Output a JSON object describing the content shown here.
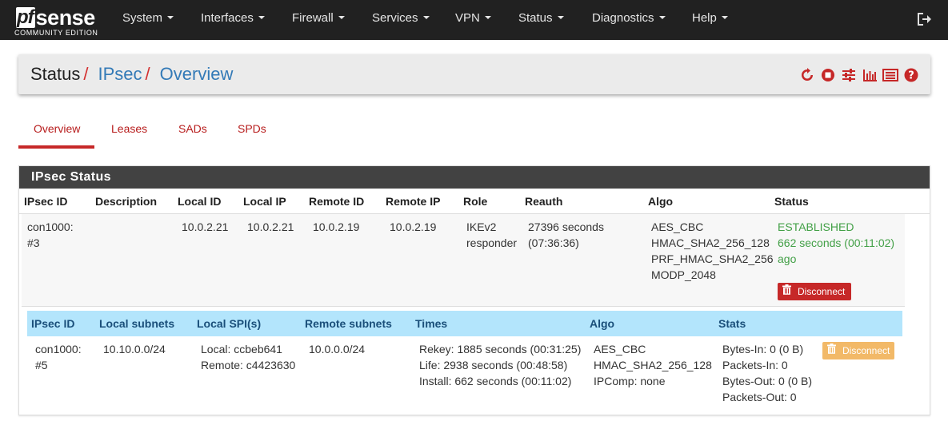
{
  "brand": {
    "logo_pf": "pf",
    "logo_sense": "sense",
    "edition": "COMMUNITY EDITION"
  },
  "nav": [
    "System",
    "Interfaces",
    "Firewall",
    "Services",
    "VPN",
    "Status",
    "Diagnostics",
    "Help"
  ],
  "breadcrumb": {
    "part1": "Status",
    "sep1": "/",
    "part2": "IPsec",
    "sep2": "/",
    "part3": "Overview"
  },
  "header_icons": [
    "refresh-icon",
    "stop-icon",
    "settings-sliders-icon",
    "chart-icon",
    "log-list-icon",
    "help-icon"
  ],
  "tabs": [
    "Overview",
    "Leases",
    "SADs",
    "SPDs"
  ],
  "panel": {
    "title": "IPsec Status",
    "columns": [
      "IPsec ID",
      "Description",
      "Local ID",
      "Local IP",
      "Remote ID",
      "Remote IP",
      "Role",
      "Reauth",
      "Algo",
      "Status"
    ],
    "row": {
      "id_line1": "con1000:",
      "id_line2": "#3",
      "description": "",
      "local_id": "10.0.2.21",
      "local_ip": "10.0.2.21",
      "remote_id": "10.0.2.19",
      "remote_ip": "10.0.2.19",
      "role_line1": "IKEv2",
      "role_line2": "responder",
      "reauth_line1": "27396 seconds",
      "reauth_line2": "(07:36:36)",
      "algo": [
        "AES_CBC",
        "HMAC_SHA2_256_128",
        "PRF_HMAC_SHA2_256",
        "MODP_2048"
      ],
      "status_line1": "ESTABLISHED",
      "status_line2": "662 seconds (00:11:02)",
      "status_line3": "ago",
      "disconnect_label": "Disconnect"
    },
    "child": {
      "columns": [
        "IPsec ID",
        "Local subnets",
        "Local SPI(s)",
        "Remote subnets",
        "Times",
        "Algo",
        "Stats"
      ],
      "row": {
        "id_line1": "con1000:",
        "id_line2": "#5",
        "local_subnets": "10.10.0.0/24",
        "spi_local": "Local: ccbeb641",
        "spi_remote": "Remote: c4423630",
        "remote_subnets": "10.0.0.0/24",
        "times": [
          "Rekey: 1885 seconds (00:31:25)",
          "Life: 2938 seconds (00:48:58)",
          "Install: 662 seconds (00:11:02)"
        ],
        "algo": [
          "AES_CBC",
          "HMAC_SHA2_256_128",
          "IPComp: none"
        ],
        "stats": [
          "Bytes-In: 0 (0 B)",
          "Packets-In: 0",
          "Bytes-Out: 0 (0 B)",
          "Packets-Out: 0"
        ],
        "disconnect_label": "Disconnect"
      }
    }
  },
  "colors": {
    "navbar": "#212121",
    "accent_red": "#c62828",
    "link_blue": "#337ab7",
    "status_green": "#43a047",
    "child_header": "#b3e5fc",
    "warning": "#f0ad4e"
  }
}
